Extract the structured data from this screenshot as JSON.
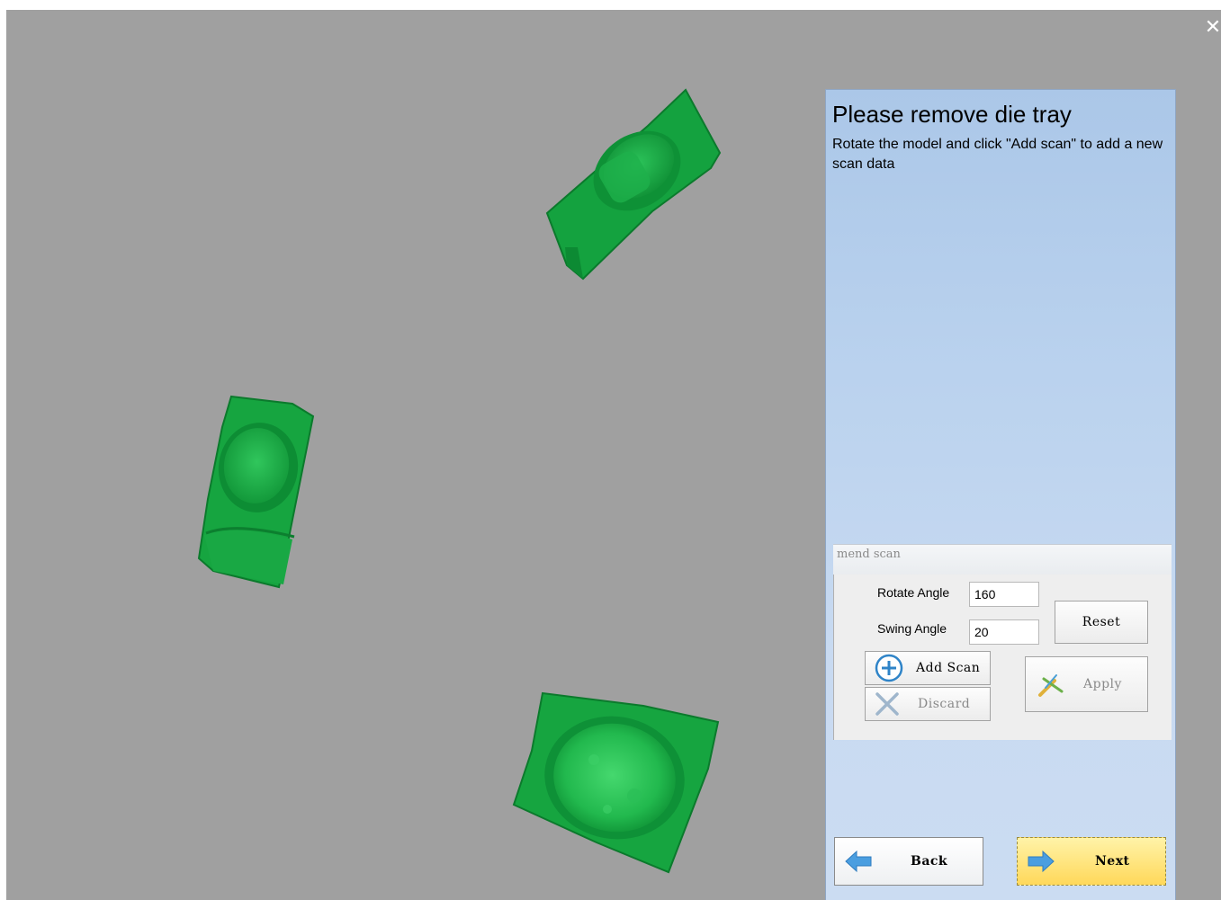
{
  "window": {
    "close_glyph": "✕"
  },
  "viewport": {
    "background": "#a0a0a0",
    "model_color": "#16a53e",
    "model_count": 3
  },
  "panel": {
    "title": "Please remove die tray",
    "description": "Rotate the model and click \"Add scan\" to add a new scan data",
    "group": {
      "legend": "mend scan",
      "rotate_angle_label": "Rotate Angle",
      "rotate_angle_value": "160",
      "swing_angle_label": "Swing Angle",
      "swing_angle_value": "20",
      "reset_label": "Reset",
      "add_scan_label": "Add Scan",
      "discard_label": "Discard",
      "apply_label": "Apply"
    },
    "back_label": "Back",
    "next_label": "Next"
  },
  "icons": {
    "add": "plus-circle-icon",
    "discard": "x-icon",
    "apply": "wand-icon",
    "back": "arrow-left-icon",
    "next": "arrow-right-icon"
  }
}
